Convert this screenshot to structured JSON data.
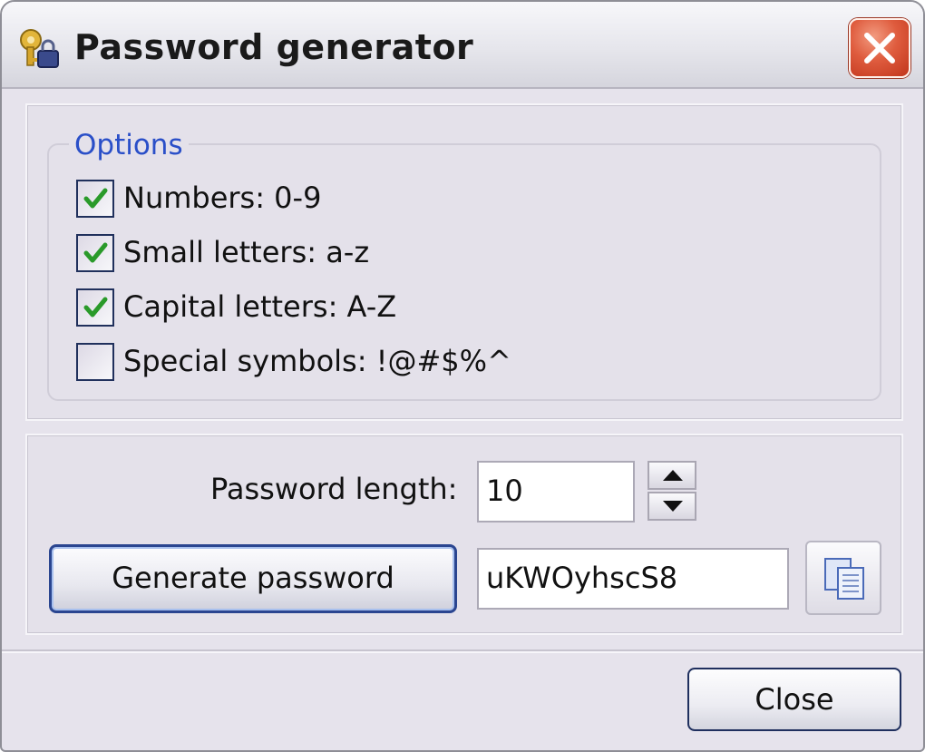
{
  "window": {
    "title": "Password generator",
    "icon": "key-lock-icon"
  },
  "options": {
    "group_label": "Options",
    "items": [
      {
        "label": "Numbers: 0-9",
        "checked": true
      },
      {
        "label": "Small letters: a-z",
        "checked": true
      },
      {
        "label": "Capital letters: A-Z",
        "checked": true
      },
      {
        "label": "Special symbols: !@#$%^",
        "checked": false
      }
    ]
  },
  "length": {
    "label": "Password length:",
    "value": "10"
  },
  "generate": {
    "button_label": "Generate password",
    "result": "uKWOyhscS8"
  },
  "footer": {
    "close_label": "Close"
  },
  "colors": {
    "accent": "#2a4fc8",
    "check": "#2a9a2a",
    "close_x": "#d9533a"
  }
}
